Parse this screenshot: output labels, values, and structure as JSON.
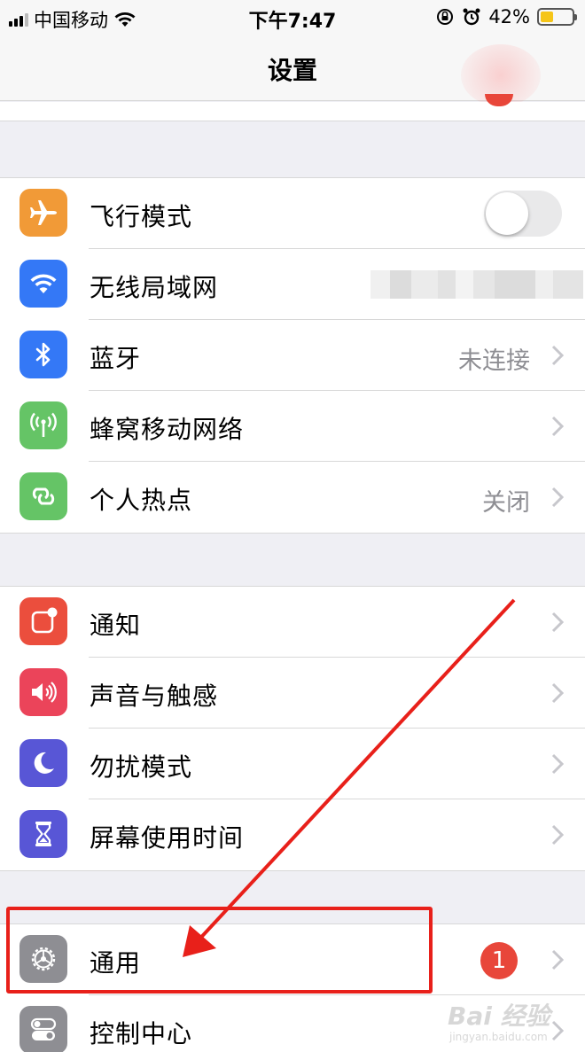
{
  "status_bar": {
    "carrier": "中国移动",
    "time": "下午7:47",
    "battery_percent": "42%",
    "battery_level": 0.42,
    "battery_color": "#f5c518",
    "icons": [
      "cellular-signal-icon",
      "wifi-icon",
      "orientation-lock-icon",
      "alarm-icon",
      "battery-icon"
    ]
  },
  "nav": {
    "title": "设置"
  },
  "groups": [
    {
      "items": [
        {
          "id": "airplane",
          "label": "飞行模式",
          "icon": "airplane-icon",
          "color": "#f19a37",
          "control": "toggle",
          "toggle_on": false
        },
        {
          "id": "wifi",
          "label": "无线局域网",
          "icon": "wifi-icon",
          "color": "#3478f6",
          "value": ""
        },
        {
          "id": "bluetooth",
          "label": "蓝牙",
          "icon": "bluetooth-icon",
          "color": "#3478f6",
          "value": "未连接"
        },
        {
          "id": "cellular",
          "label": "蜂窝移动网络",
          "icon": "antenna-icon",
          "color": "#65c466",
          "value": ""
        },
        {
          "id": "hotspot",
          "label": "个人热点",
          "icon": "hotspot-link-icon",
          "color": "#65c466",
          "value": "关闭"
        }
      ]
    },
    {
      "items": [
        {
          "id": "notifications",
          "label": "通知",
          "icon": "notifications-icon",
          "color": "#eb4e3d"
        },
        {
          "id": "sounds",
          "label": "声音与触感",
          "icon": "speaker-icon",
          "color": "#eb445a"
        },
        {
          "id": "dnd",
          "label": "勿扰模式",
          "icon": "moon-icon",
          "color": "#5856d6"
        },
        {
          "id": "screentime",
          "label": "屏幕使用时间",
          "icon": "hourglass-icon",
          "color": "#5856d6"
        }
      ]
    },
    {
      "items": [
        {
          "id": "general",
          "label": "通用",
          "icon": "gear-icon",
          "color": "#8e8e93",
          "badge": "1"
        },
        {
          "id": "control",
          "label": "控制中心",
          "icon": "toggles-icon",
          "color": "#8e8e93"
        }
      ]
    }
  ],
  "annotation": {
    "highlight_color": "#e8201a"
  },
  "watermark": {
    "text": "Bai 经验",
    "sub": "jingyan.baidu.com"
  }
}
